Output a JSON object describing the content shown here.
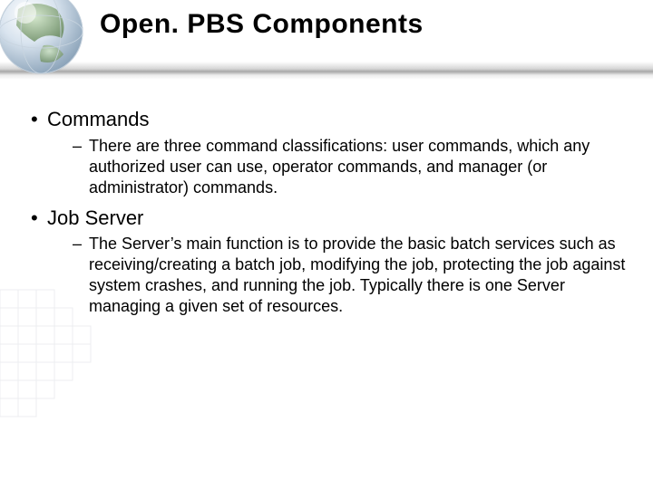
{
  "title": "Open. PBS Components",
  "bullets": [
    {
      "label": "Commands",
      "sub": [
        "There are three command classifications: user commands, which any authorized user can use, operator commands, and manager (or administrator) commands."
      ]
    },
    {
      "label": "Job Server",
      "sub": [
        "The Server’s main function is to provide the basic batch services such as receiving/creating a batch job, modifying the job, protecting the job against system crashes, and running the job. Typically there is one Server managing a given set of resources."
      ]
    }
  ]
}
